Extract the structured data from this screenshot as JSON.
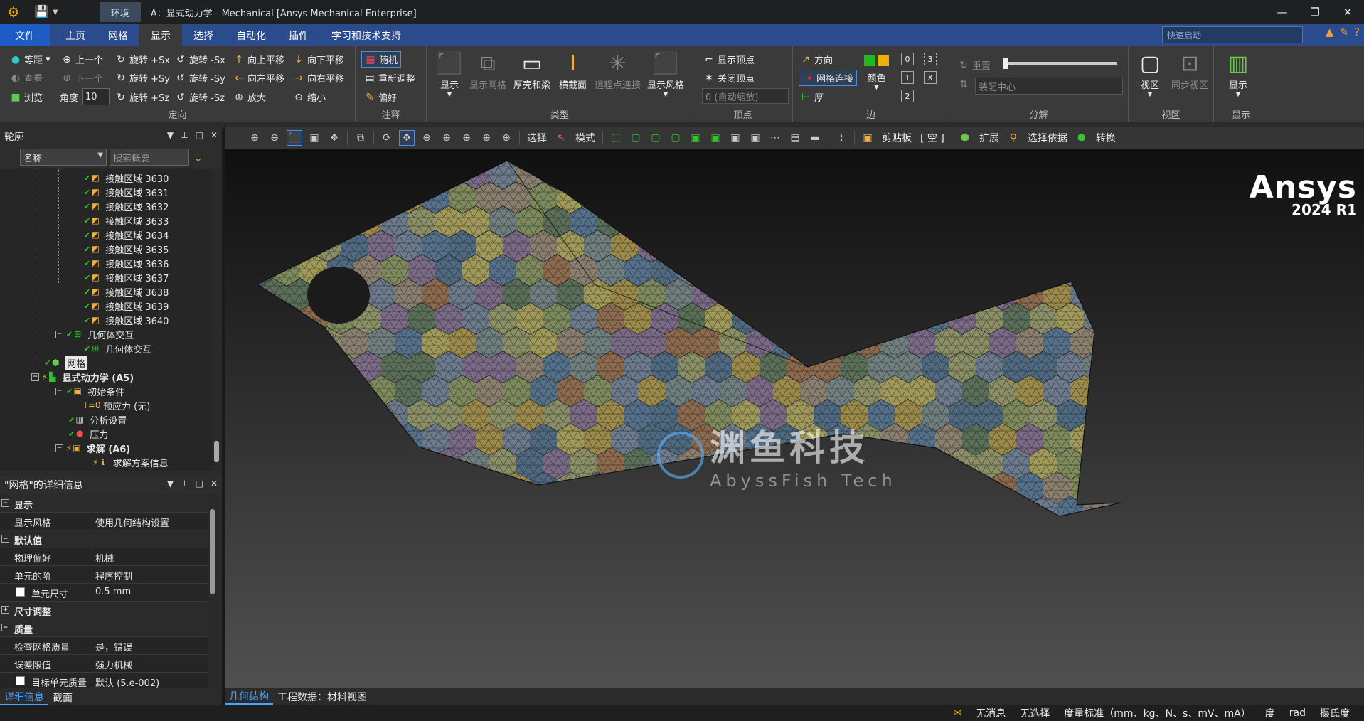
{
  "title_bar": {
    "context_tab": "环境",
    "window_title": "A：显式动力学 - Mechanical [Ansys Mechanical Enterprise]"
  },
  "tabs": [
    {
      "label": "文件"
    },
    {
      "label": "主页"
    },
    {
      "label": "网格"
    },
    {
      "label": "显示"
    },
    {
      "label": "选择"
    },
    {
      "label": "自动化"
    },
    {
      "label": "插件"
    },
    {
      "label": "学习和技术支持"
    }
  ],
  "active_tab": "显示",
  "quick_launch": {
    "placeholder": "快速启动"
  },
  "ribbon": {
    "orient": {
      "label": "定向",
      "equidistant": "等距",
      "look": "查看",
      "browse": "浏览",
      "prev": "上一个",
      "next": "下一个",
      "angle_label": "角度",
      "angle_value": "10",
      "rot_px": "旋转 +Sx",
      "rot_py": "旋转 +Sy",
      "rot_pz": "旋转 +Sz",
      "rot_mx": "旋转 -Sx",
      "rot_my": "旋转 -Sy",
      "rot_mz": "旋转 -Sz",
      "pan_up": "向上平移",
      "pan_left": "向左平移",
      "zoom_in": "放大",
      "pan_down": "向下平移",
      "pan_right": "向右平移",
      "zoom_out": "缩小"
    },
    "annot": {
      "label": "注释",
      "random": "随机",
      "readjust": "重新调整",
      "preference": "偏好"
    },
    "type": {
      "label": "类型",
      "show": "显示",
      "show_mesh": "显示网格",
      "shell_beam": "厚壳和梁",
      "cross_section": "横截面",
      "remote_points": "远程点连接",
      "show_style": "显示风格"
    },
    "vertex": {
      "label": "顶点",
      "show_vertex": "显示顶点",
      "close_vertex": "关闭顶点",
      "auto_scale": "0.(自动缩放)"
    },
    "edge": {
      "label": "边",
      "direction": "方向",
      "mesh_connect": "网格连接",
      "thick": "厚",
      "color": "颜色",
      "b0": "0",
      "b1": "1",
      "b2": "2",
      "b3": "3",
      "bx": "X"
    },
    "explode": {
      "label": "分解",
      "reset": "重置",
      "assembly_center": "装配中心"
    },
    "viewport": {
      "label": "视区",
      "viewport": "视区",
      "sync": "同步视区"
    },
    "display": {
      "label": "显示",
      "display": "显示"
    }
  },
  "outline": {
    "header": "轮廓",
    "name_filter": "名称",
    "search_placeholder": "搜索概要",
    "items": [
      {
        "label": "接触区域 3630"
      },
      {
        "label": "接触区域 3631"
      },
      {
        "label": "接触区域 3632"
      },
      {
        "label": "接触区域 3633"
      },
      {
        "label": "接触区域 3634"
      },
      {
        "label": "接触区域 3635"
      },
      {
        "label": "接触区域 3636"
      },
      {
        "label": "接触区域 3637"
      },
      {
        "label": "接触区域 3638"
      },
      {
        "label": "接触区域 3639"
      },
      {
        "label": "接触区域 3640"
      },
      {
        "label": "几何体交互"
      },
      {
        "label": "几何体交互"
      },
      {
        "label": "网格"
      },
      {
        "label": "显式动力学 (A5)"
      },
      {
        "label": "初始条件"
      },
      {
        "label": "预应力 (无)"
      },
      {
        "label": "分析设置"
      },
      {
        "label": "压力"
      },
      {
        "label": "求解 (A6)"
      },
      {
        "label": "求解方案信息"
      }
    ]
  },
  "details": {
    "header": "\"网格\"的详细信息",
    "rows": [
      {
        "k": "显示",
        "v": ""
      },
      {
        "k": "显示风格",
        "v": "使用几何结构设置"
      },
      {
        "k": "默认值",
        "v": ""
      },
      {
        "k": "物理偏好",
        "v": "机械"
      },
      {
        "k": "单元的阶",
        "v": "程序控制"
      },
      {
        "k": "单元尺寸",
        "v": "0.5 mm"
      },
      {
        "k": "尺寸调整",
        "v": ""
      },
      {
        "k": "质量",
        "v": ""
      },
      {
        "k": "检查网格质量",
        "v": "是，错误"
      },
      {
        "k": "误差限值",
        "v": "强力机械"
      },
      {
        "k": "目标单元质量",
        "v": "默认 (5.e-002)"
      }
    ],
    "tabs": [
      "详细信息",
      "截面"
    ]
  },
  "graphics_toolbar": {
    "select": "选择",
    "mode": "模式",
    "clipboard": "剪贴板",
    "empty": "[ 空 ]",
    "extend": "扩展",
    "select_by": "选择依据",
    "convert": "转换"
  },
  "viewport": {
    "brand": "Ansys",
    "version": "2024 R1",
    "watermark_cn": "渊鱼科技",
    "watermark_en": "AbyssFish Tech"
  },
  "viewport_tabs": [
    "几何结构",
    "工程数据：材料视图"
  ],
  "status": {
    "messages": "无消息",
    "selection": "无选择",
    "units": "度量标准（mm、kg、N、s、mV、mA）",
    "deg": "度",
    "rad": "rad",
    "temp": "摄氏度"
  },
  "colors": {
    "ribbon_blue": "#2a4c8c",
    "file_blue": "#1d5cc4",
    "accent": "#4aa3ff",
    "check": "#2ec52e"
  }
}
